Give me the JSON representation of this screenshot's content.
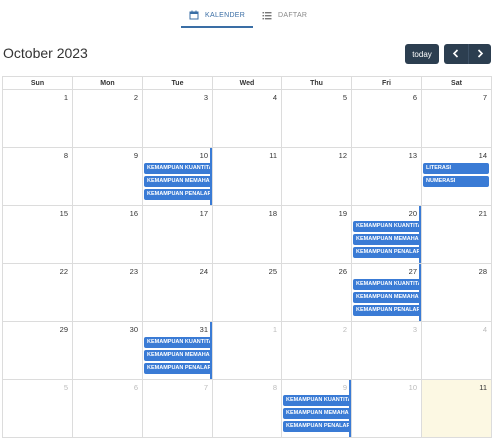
{
  "tabs": [
    {
      "label": "KALENDER",
      "icon": "calendar-icon",
      "active": true
    },
    {
      "label": "DAFTAR",
      "icon": "list-icon",
      "active": false
    }
  ],
  "calendar": {
    "title": "October 2023",
    "today_label": "today",
    "weekdays": [
      "Sun",
      "Mon",
      "Tue",
      "Wed",
      "Thu",
      "Fri",
      "Sat"
    ],
    "weeks": [
      [
        1,
        2,
        3,
        4,
        5,
        6,
        7
      ],
      [
        8,
        9,
        10,
        11,
        12,
        13,
        14
      ],
      [
        15,
        16,
        17,
        18,
        19,
        20,
        21
      ],
      [
        22,
        23,
        24,
        25,
        26,
        27,
        28
      ],
      [
        29,
        30,
        31,
        1,
        2,
        3,
        4
      ],
      [
        5,
        6,
        7,
        8,
        9,
        10,
        11
      ]
    ],
    "other_month": [
      [
        4,
        3
      ],
      [
        4,
        4
      ],
      [
        4,
        5
      ],
      [
        4,
        6
      ],
      [
        5,
        0
      ],
      [
        5,
        1
      ],
      [
        5,
        2
      ],
      [
        5,
        3
      ],
      [
        5,
        4
      ],
      [
        5,
        5
      ]
    ],
    "today": [
      5,
      6
    ],
    "colors": {
      "event": "#3a7bd5",
      "today_bg": "#fcf8e3",
      "accent": "#3a6ea5",
      "button": "#2c3e50"
    },
    "event_groups": [
      {
        "week": 1,
        "day": 2,
        "events": [
          "KEMAMPUAN KUANTITATIF",
          "KEMAMPUAN MEMAHAMI BACAAN DAN MENULIS",
          "KEMAMPUAN PENALARAN UMUM"
        ]
      },
      {
        "week": 1,
        "day": 6,
        "events": [
          "LITERASI",
          "NUMERASI"
        ]
      },
      {
        "week": 2,
        "day": 5,
        "events": [
          "KEMAMPUAN KUANTITATIF",
          "KEMAMPUAN MEMAHAMI BACAAN DAN MENULIS",
          "KEMAMPUAN PENALARAN UMUM"
        ]
      },
      {
        "week": 3,
        "day": 5,
        "events": [
          "KEMAMPUAN KUANTITATIF",
          "KEMAMPUAN MEMAHAMI BACAAN DAN MENULIS",
          "KEMAMPUAN PENALARAN UMUM"
        ]
      },
      {
        "week": 4,
        "day": 2,
        "events": [
          "KEMAMPUAN KUANTITATIF",
          "KEMAMPUAN MEMAHAMI BACAAN DAN MENULIS",
          "KEMAMPUAN PENALARAN UMUM"
        ]
      },
      {
        "week": 5,
        "day": 4,
        "events": [
          "KEMAMPUAN KUANTITATIF",
          "KEMAMPUAN MEMAHAMI BACAAN DAN MENULIS",
          "KEMAMPUAN PENALARAN UMUM"
        ]
      }
    ]
  }
}
